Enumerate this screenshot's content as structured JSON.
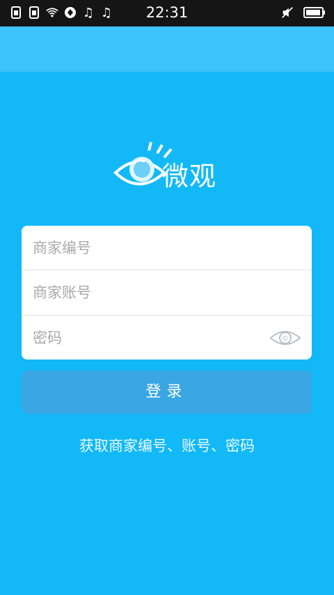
{
  "status_bar": {
    "time": "22:31",
    "left_icons": [
      "sim-card-icon",
      "sim-card-icon",
      "wifi-icon",
      "browser-icon",
      "music-note-icon",
      "music-note-icon"
    ],
    "right_icons": [
      "mute-icon",
      "battery-icon"
    ]
  },
  "logo": {
    "text": "微观"
  },
  "form": {
    "merchant_id": {
      "placeholder": "商家编号",
      "value": ""
    },
    "account": {
      "placeholder": "商家账号",
      "value": ""
    },
    "password": {
      "placeholder": "密码",
      "value": ""
    }
  },
  "actions": {
    "login_label": "登录",
    "help_link_label": "获取商家编号、账号、密码"
  },
  "colors": {
    "background": "#12b9f6",
    "top_bar": "#3ec3fb",
    "button": "#3aa6e4",
    "card": "#ffffff"
  }
}
